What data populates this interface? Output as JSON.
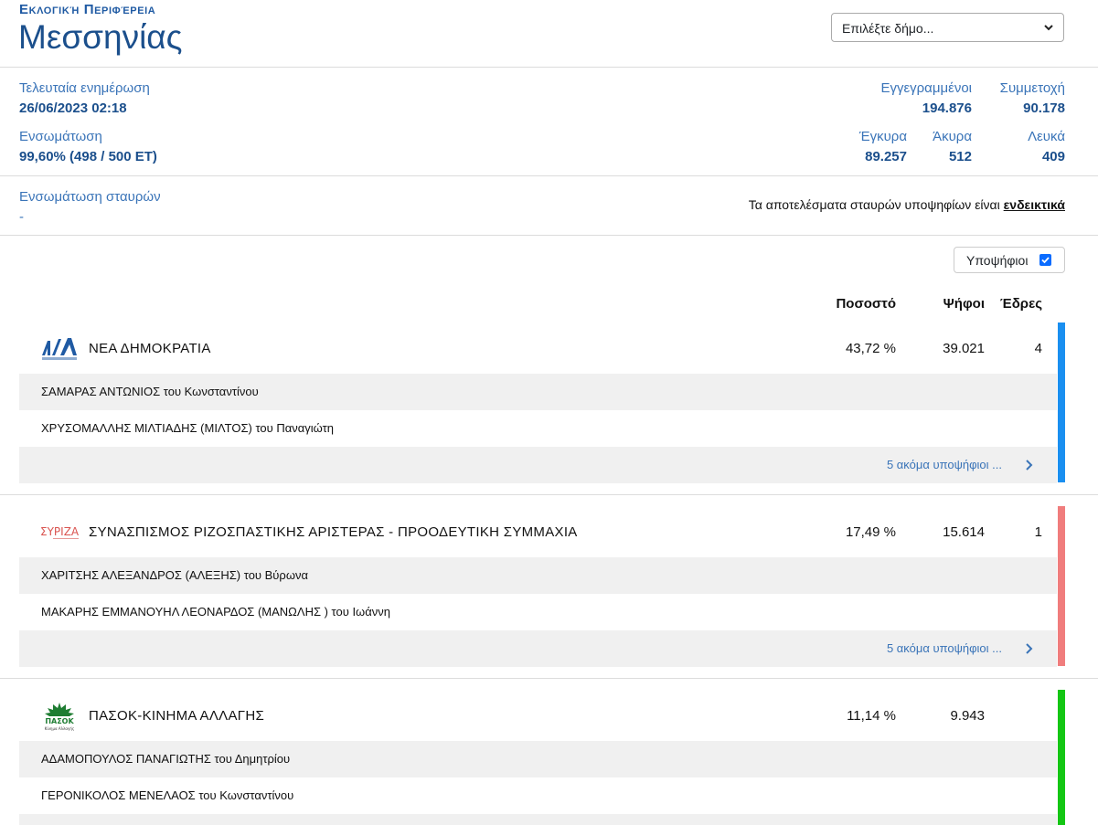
{
  "header": {
    "region_label": "Εκλογική Περιφέρεια",
    "region_name": "Μεσσηνίας",
    "municipality_select": "Επιλέξτε δήμο..."
  },
  "stats": {
    "last_update_label": "Τελευταία ενημέρωση",
    "last_update_value": "26/06/2023 02:18",
    "incorporation_label": "Ενσωμάτωση",
    "incorporation_value": "99,60% (498 / 500 ΕΤ)",
    "registered_label": "Εγγεγραμμένοι",
    "registered_value": "194.876",
    "turnout_label": "Συμμετοχή",
    "turnout_value": "90.178",
    "valid_label": "Έγκυρα",
    "valid_value": "89.257",
    "invalid_label": "Άκυρα",
    "invalid_value": "512",
    "blank_label": "Λευκά",
    "blank_value": "409",
    "cross_label": "Ενσωμάτωση σταυρών",
    "cross_value": "-",
    "note_text": "Τα αποτελέσματα σταυρών υποψηφίων είναι",
    "note_link": "ενδεικτικά"
  },
  "candidates_toggle": {
    "label": "Υποψήφιοι",
    "checked": true
  },
  "columns": {
    "percent": "Ποσοστό",
    "votes": "Ψήφοι",
    "seats": "Έδρες"
  },
  "parties": [
    {
      "name": "ΝΕΑ ΔΗΜΟΚΡΑΤΙΑ",
      "logo_text": "ΝΕΑ ΔΗΜΟΚΡΑΤΙΑ",
      "percent": "43,72 %",
      "votes": "39.021",
      "seats": "4",
      "color": "#1a8ff0",
      "candidates": [
        "ΣΑΜΑΡΑΣ ΑΝΤΩΝΙΟΣ του Κωνσταντίνου",
        "ΧΡΥΣΟΜΑΛΛΗΣ ΜΙΛΤΙΑΔΗΣ (ΜΙΛΤΟΣ) του Παναγιώτη"
      ],
      "more": "5 ακόμα υποψήφιοι ..."
    },
    {
      "name": "ΣΥΝΑΣΠΙΣΜΟΣ ΡΙΖΟΣΠΑΣΤΙΚΗΣ ΑΡΙΣΤΕΡΑΣ - ΠΡΟΟΔΕΥΤΙΚΗ ΣΥΜΜΑΧΙΑ",
      "logo_text": "ΣΥΡΙΖΑ",
      "percent": "17,49 %",
      "votes": "15.614",
      "seats": "1",
      "color": "#f07d7d",
      "candidates": [
        "ΧΑΡΙΤΣΗΣ ΑΛΕΞΑΝΔΡΟΣ (ΑΛΕΞΗΣ) του Βύρωνα",
        "ΜΑΚΑΡΗΣ ΕΜΜΑΝΟΥΗΛ ΛΕΟΝΑΡΔΟΣ (ΜΑΝΩΛΗΣ ) του Ιωάννη"
      ],
      "more": "5 ακόμα υποψήφιοι ..."
    },
    {
      "name": "ΠΑΣΟΚ-ΚΙΝΗΜΑ ΑΛΛΑΓΗΣ",
      "logo_text": "ΠΑΣΟΚ",
      "logo_subtext": "Κίνημα Αλλαγής",
      "percent": "11,14 %",
      "votes": "9.943",
      "seats": "",
      "color": "#14c614",
      "candidates": [
        "ΑΔΑΜΟΠΟΥΛΟΣ ΠΑΝΑΓΙΩΤΗΣ του Δημητρίου",
        "ΓΕΡΟΝΙΚΟΛΟΣ ΜΕΝΕΛΑΟΣ του Κωνσταντίνου"
      ]
    }
  ]
}
